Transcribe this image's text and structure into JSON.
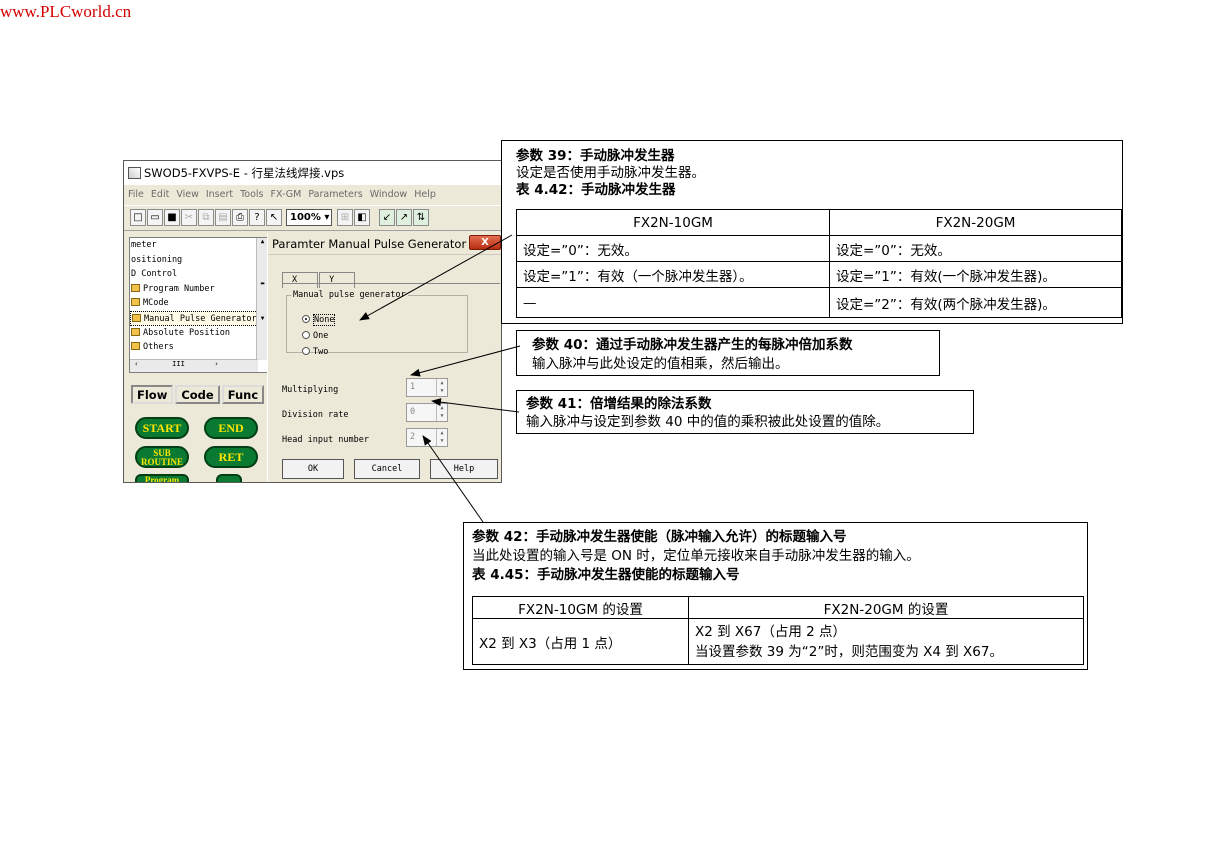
{
  "watermark": "www.PLCworld.cn",
  "app": {
    "title": "SWOD5-FXVPS-E - 行星法线焊接.vps",
    "menu": [
      "File",
      "Edit",
      "View",
      "Insert",
      "Tools",
      "FX-GM",
      "Parameters",
      "Window",
      "Help"
    ],
    "zoom": "100%",
    "tree": [
      "meter",
      "ositioning",
      "D Control",
      "Program Number",
      "MCode",
      "Manual Pulse Generator",
      "Absolute Position",
      "Others"
    ],
    "tree_selected_index": 5,
    "scroll_marker": "III",
    "panel_tabs": [
      "Flow",
      "Code",
      "Func"
    ],
    "sfc_blocks": [
      "START",
      "END",
      "SUB ROUTINE",
      "RET",
      "Program"
    ]
  },
  "dialog": {
    "title": "Paramter Manual Pulse Generator",
    "close": "X",
    "tabs": [
      "X",
      "Y"
    ],
    "group_label": "Manual pulse generator",
    "options": [
      "None",
      "One",
      "Two"
    ],
    "selected_option": 0,
    "fields": [
      {
        "label": "Multiplying",
        "value": "1"
      },
      {
        "label": "Division rate",
        "value": "0"
      },
      {
        "label": "Head input number",
        "value": "2"
      }
    ],
    "buttons": [
      "OK",
      "Cancel",
      "Help"
    ]
  },
  "param39": {
    "title": "参数 39：手动脉冲发生器",
    "desc": "设定是否使用手动脉冲发生器。",
    "table_title": "表 4.42：手动脉冲发生器",
    "headers": [
      "FX2N-10GM",
      "FX2N-20GM"
    ],
    "rows": [
      [
        "设定=”0”：无效。",
        "设定=”0”：无效。"
      ],
      [
        "设定=”1”：有效（一个脉冲发生器）。",
        "设定=”1”：有效(一个脉冲发生器)。"
      ],
      [
        "—",
        "设定=”2”：有效(两个脉冲发生器)。"
      ]
    ]
  },
  "param40": {
    "title": "参数 40：通过手动脉冲发生器产生的每脉冲倍加系数",
    "desc": "输入脉冲与此处设定的值相乘，然后输出。"
  },
  "param41": {
    "title": "参数 41：倍增结果的除法系数",
    "desc": "输入脉冲与设定到参数 40 中的值的乘积被此处设置的值除。"
  },
  "param42": {
    "title": "参数 42：手动脉冲发生器使能（脉冲输入允许）的标题输入号",
    "desc": "当此处设置的输入号是 ON 时，定位单元接收来自手动脉冲发生器的输入。",
    "table_title": "表 4.45：手动脉冲发生器使能的标题输入号",
    "headers": [
      "FX2N-10GM 的设置",
      "FX2N-20GM 的设置"
    ],
    "row_left": "X2 到 X3（占用 1 点）",
    "row_right_1": "X2 到 X67（占用 2 点）",
    "row_right_2": "当设置参数 39 为“2”时，则范围变为 X4 到 X67。"
  }
}
